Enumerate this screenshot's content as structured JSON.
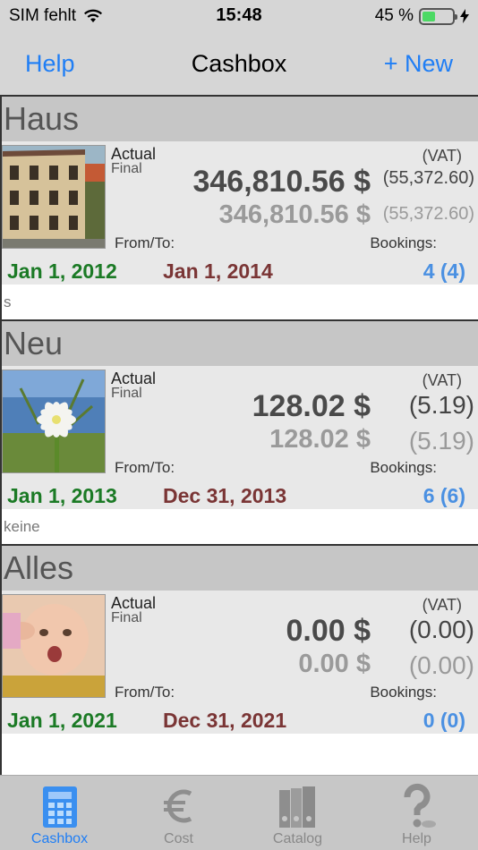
{
  "status": {
    "carrier": "SIM fehlt",
    "time": "15:48",
    "battery_pct": "45 %",
    "battery_level": 0.45
  },
  "nav": {
    "left_label": "Help",
    "title": "Cashbox",
    "right_label": "+ New"
  },
  "sections": [
    {
      "name": "Haus",
      "actual_label": "Actual",
      "final_label": "Final",
      "vat_label": "(VAT)",
      "actual_amount": "346,810.56 $",
      "actual_vat": "(55,372.60)",
      "final_amount": "346,810.56 $",
      "final_vat": "(55,372.60)",
      "fromto_label": "From/To:",
      "bookings_label": "Bookings:",
      "date_from": "Jan 1, 2012",
      "date_to": "Jan 1, 2014",
      "bookings": "4 (4)",
      "note": "s",
      "image": "building-photo"
    },
    {
      "name": "Neu",
      "actual_label": "Actual",
      "final_label": "Final",
      "vat_label": "(VAT)",
      "actual_amount": "128.02 $",
      "actual_vat": "(5.19)",
      "final_amount": "128.02 $",
      "final_vat": "(5.19)",
      "fromto_label": "From/To:",
      "bookings_label": "Bookings:",
      "date_from": "Jan 1, 2013",
      "date_to": "Dec 31, 2013",
      "bookings": "6 (6)",
      "note": "keine",
      "image": "flower-photo"
    },
    {
      "name": "Alles",
      "actual_label": "Actual",
      "final_label": "Final",
      "vat_label": "(VAT)",
      "actual_amount": "0.00 $",
      "actual_vat": "(0.00)",
      "final_amount": "0.00 $",
      "final_vat": "(0.00)",
      "fromto_label": "From/To:",
      "bookings_label": "Bookings:",
      "date_from": "Jan 1, 2021",
      "date_to": "Dec 31, 2021",
      "bookings": "0 (0)",
      "note": "",
      "image": "baby-photo"
    }
  ],
  "tabs": [
    {
      "label": "Cashbox",
      "icon": "cashbox-icon",
      "active": true
    },
    {
      "label": "Cost",
      "icon": "euro-icon",
      "active": false
    },
    {
      "label": "Catalog",
      "icon": "binders-icon",
      "active": false
    },
    {
      "label": "Help",
      "icon": "question-icon",
      "active": false
    }
  ],
  "colors": {
    "accent": "#1f7ef5",
    "date_from": "#1b7a25",
    "date_to": "#7a3535",
    "bookings": "#4a90e2"
  }
}
